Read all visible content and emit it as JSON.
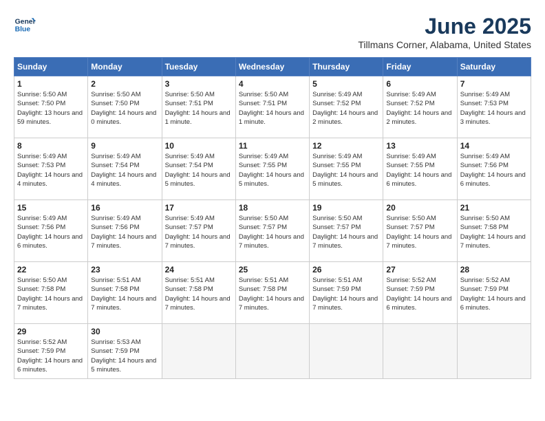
{
  "logo": {
    "line1": "General",
    "line2": "Blue"
  },
  "title": "June 2025",
  "location": "Tillmans Corner, Alabama, United States",
  "weekdays": [
    "Sunday",
    "Monday",
    "Tuesday",
    "Wednesday",
    "Thursday",
    "Friday",
    "Saturday"
  ],
  "weeks": [
    [
      {
        "day": "1",
        "sunrise": "5:50 AM",
        "sunset": "7:50 PM",
        "daylight": "13 hours and 59 minutes."
      },
      {
        "day": "2",
        "sunrise": "5:50 AM",
        "sunset": "7:50 PM",
        "daylight": "14 hours and 0 minutes."
      },
      {
        "day": "3",
        "sunrise": "5:50 AM",
        "sunset": "7:51 PM",
        "daylight": "14 hours and 1 minute."
      },
      {
        "day": "4",
        "sunrise": "5:50 AM",
        "sunset": "7:51 PM",
        "daylight": "14 hours and 1 minute."
      },
      {
        "day": "5",
        "sunrise": "5:49 AM",
        "sunset": "7:52 PM",
        "daylight": "14 hours and 2 minutes."
      },
      {
        "day": "6",
        "sunrise": "5:49 AM",
        "sunset": "7:52 PM",
        "daylight": "14 hours and 2 minutes."
      },
      {
        "day": "7",
        "sunrise": "5:49 AM",
        "sunset": "7:53 PM",
        "daylight": "14 hours and 3 minutes."
      }
    ],
    [
      {
        "day": "8",
        "sunrise": "5:49 AM",
        "sunset": "7:53 PM",
        "daylight": "14 hours and 4 minutes."
      },
      {
        "day": "9",
        "sunrise": "5:49 AM",
        "sunset": "7:54 PM",
        "daylight": "14 hours and 4 minutes."
      },
      {
        "day": "10",
        "sunrise": "5:49 AM",
        "sunset": "7:54 PM",
        "daylight": "14 hours and 5 minutes."
      },
      {
        "day": "11",
        "sunrise": "5:49 AM",
        "sunset": "7:55 PM",
        "daylight": "14 hours and 5 minutes."
      },
      {
        "day": "12",
        "sunrise": "5:49 AM",
        "sunset": "7:55 PM",
        "daylight": "14 hours and 5 minutes."
      },
      {
        "day": "13",
        "sunrise": "5:49 AM",
        "sunset": "7:55 PM",
        "daylight": "14 hours and 6 minutes."
      },
      {
        "day": "14",
        "sunrise": "5:49 AM",
        "sunset": "7:56 PM",
        "daylight": "14 hours and 6 minutes."
      }
    ],
    [
      {
        "day": "15",
        "sunrise": "5:49 AM",
        "sunset": "7:56 PM",
        "daylight": "14 hours and 6 minutes."
      },
      {
        "day": "16",
        "sunrise": "5:49 AM",
        "sunset": "7:56 PM",
        "daylight": "14 hours and 7 minutes."
      },
      {
        "day": "17",
        "sunrise": "5:49 AM",
        "sunset": "7:57 PM",
        "daylight": "14 hours and 7 minutes."
      },
      {
        "day": "18",
        "sunrise": "5:50 AM",
        "sunset": "7:57 PM",
        "daylight": "14 hours and 7 minutes."
      },
      {
        "day": "19",
        "sunrise": "5:50 AM",
        "sunset": "7:57 PM",
        "daylight": "14 hours and 7 minutes."
      },
      {
        "day": "20",
        "sunrise": "5:50 AM",
        "sunset": "7:57 PM",
        "daylight": "14 hours and 7 minutes."
      },
      {
        "day": "21",
        "sunrise": "5:50 AM",
        "sunset": "7:58 PM",
        "daylight": "14 hours and 7 minutes."
      }
    ],
    [
      {
        "day": "22",
        "sunrise": "5:50 AM",
        "sunset": "7:58 PM",
        "daylight": "14 hours and 7 minutes."
      },
      {
        "day": "23",
        "sunrise": "5:51 AM",
        "sunset": "7:58 PM",
        "daylight": "14 hours and 7 minutes."
      },
      {
        "day": "24",
        "sunrise": "5:51 AM",
        "sunset": "7:58 PM",
        "daylight": "14 hours and 7 minutes."
      },
      {
        "day": "25",
        "sunrise": "5:51 AM",
        "sunset": "7:58 PM",
        "daylight": "14 hours and 7 minutes."
      },
      {
        "day": "26",
        "sunrise": "5:51 AM",
        "sunset": "7:59 PM",
        "daylight": "14 hours and 7 minutes."
      },
      {
        "day": "27",
        "sunrise": "5:52 AM",
        "sunset": "7:59 PM",
        "daylight": "14 hours and 6 minutes."
      },
      {
        "day": "28",
        "sunrise": "5:52 AM",
        "sunset": "7:59 PM",
        "daylight": "14 hours and 6 minutes."
      }
    ],
    [
      {
        "day": "29",
        "sunrise": "5:52 AM",
        "sunset": "7:59 PM",
        "daylight": "14 hours and 6 minutes."
      },
      {
        "day": "30",
        "sunrise": "5:53 AM",
        "sunset": "7:59 PM",
        "daylight": "14 hours and 5 minutes."
      },
      null,
      null,
      null,
      null,
      null
    ]
  ]
}
